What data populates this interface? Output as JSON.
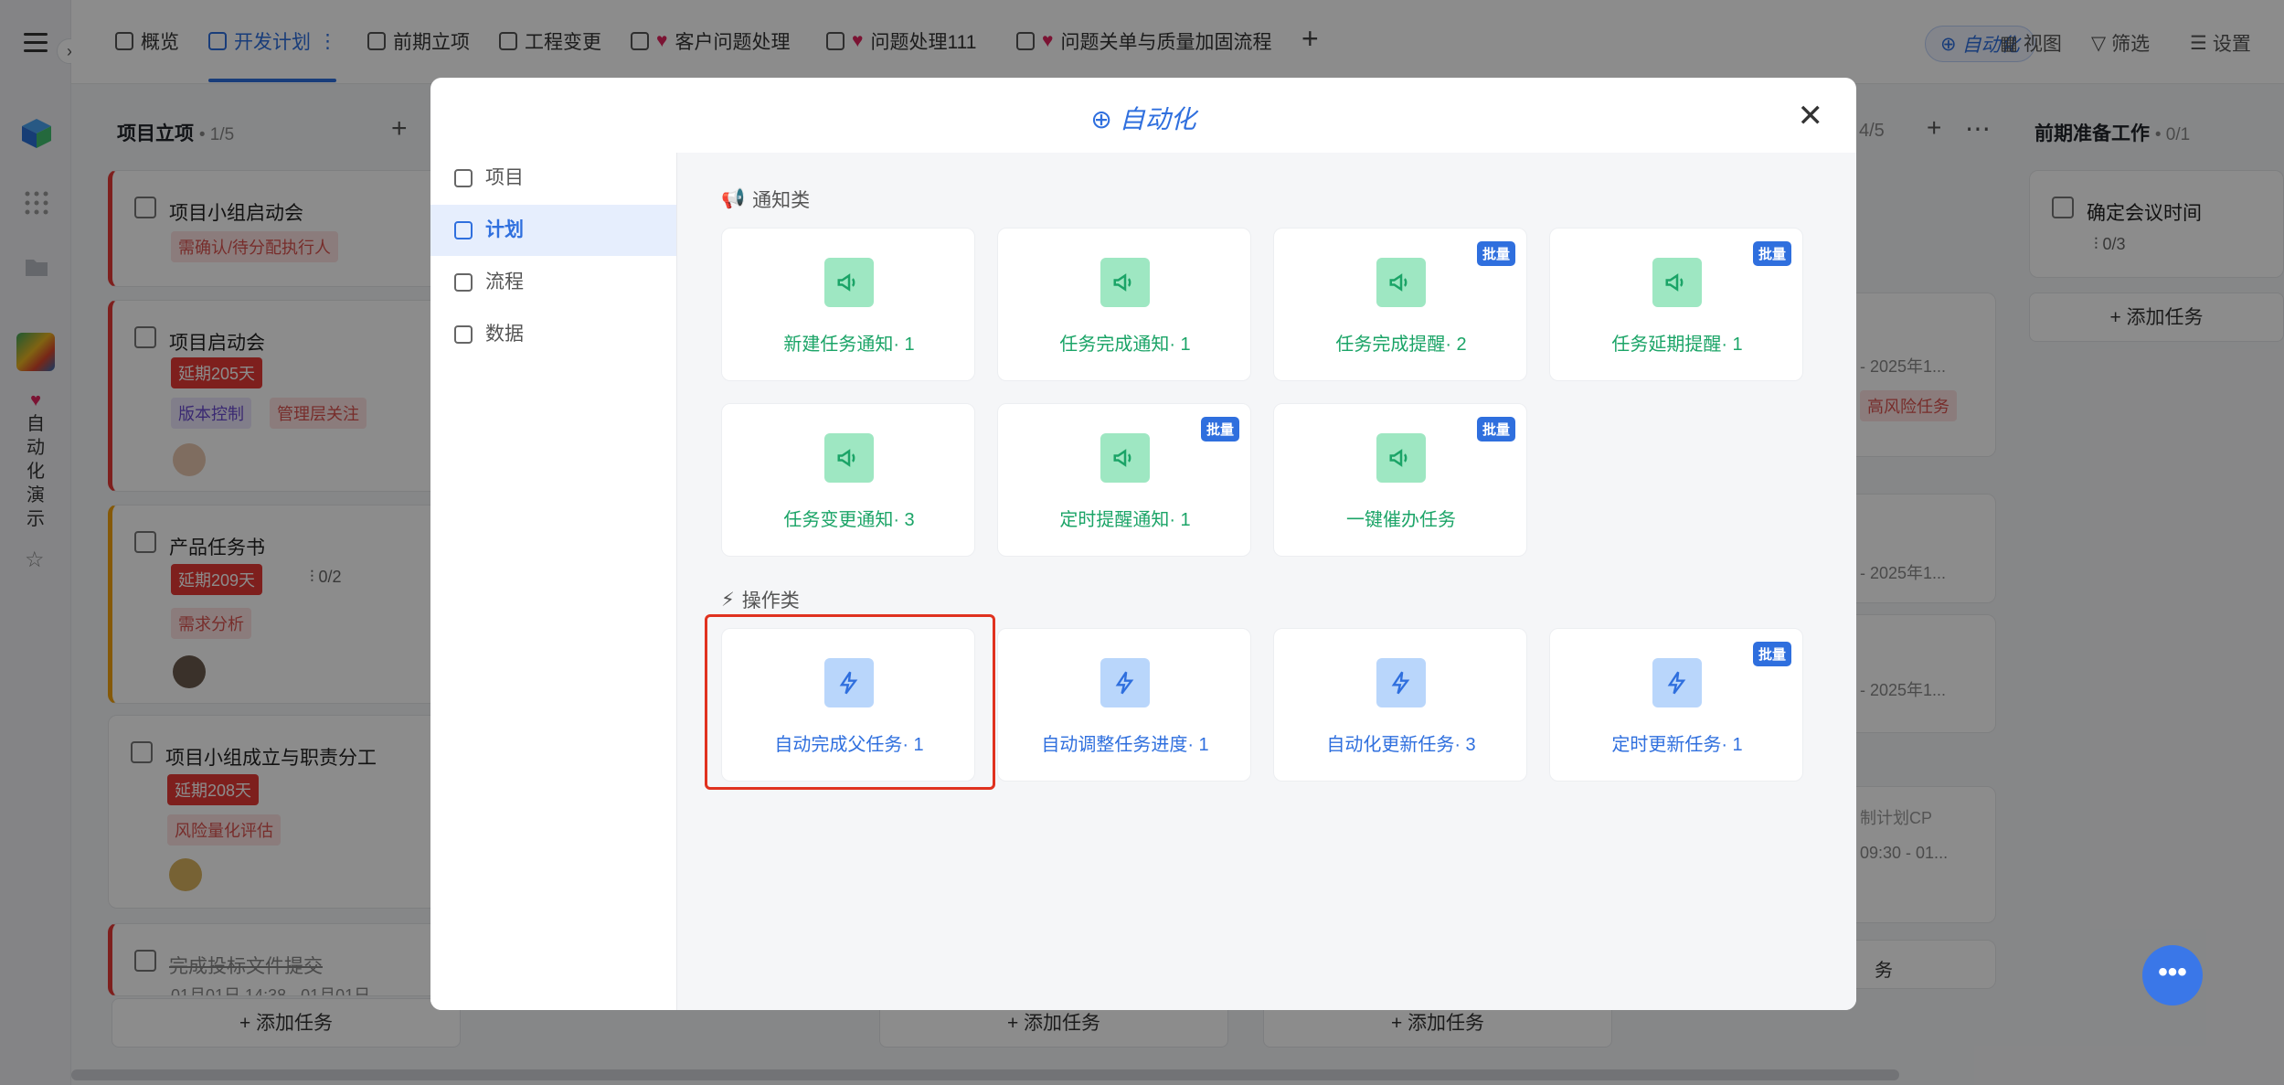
{
  "app": {
    "rail": {
      "workspace_label": "自动化演示"
    },
    "tabs": [
      {
        "label": "概览"
      },
      {
        "label": "开发计划"
      },
      {
        "label": "前期立项"
      },
      {
        "label": "工程变更"
      },
      {
        "label": "客户问题处理"
      },
      {
        "label": "问题处理111"
      },
      {
        "label": "问题关单与质量加固流程"
      }
    ],
    "toolbar": {
      "automation": "自动化",
      "view": "视图",
      "filter": "筛选",
      "settings": "设置"
    }
  },
  "board": {
    "columns": [
      {
        "title": "项目立项",
        "count": "• 1/5"
      },
      {
        "title": "前期准备工作",
        "count": "• 0/1"
      }
    ],
    "partial_count": "4/5",
    "cards": [
      {
        "title": "项目小组启动会",
        "tags": [
          "需确认/待分配执行人"
        ]
      },
      {
        "title": "项目启动会",
        "delay": "延期205天",
        "tags": [
          "版本控制",
          "管理层关注"
        ]
      },
      {
        "title": "产品任务书",
        "delay": "延期209天",
        "sub": "0/2",
        "tags": [
          "需求分析"
        ]
      },
      {
        "title": "项目小组成立与职责分工",
        "delay": "延期208天",
        "tags": [
          "风险量化评估"
        ]
      },
      {
        "title": "完成投标文件提交",
        "date": "01月01日 14:38 - 01月01日 ..."
      }
    ],
    "right_card": {
      "title": "确定会议时间",
      "sub": "0/3"
    },
    "right_col_snippets": [
      "- 2025年1...",
      "高风险任务",
      "- 2025年1...",
      "- 2025年1...",
      "制计划CP",
      "09:30 - 01...",
      "务"
    ],
    "add_task": "添加任务"
  },
  "modal": {
    "title": "自动化",
    "nav": [
      {
        "label": "项目"
      },
      {
        "label": "计划"
      },
      {
        "label": "流程"
      },
      {
        "label": "数据"
      }
    ],
    "sections": [
      {
        "title": "通知类",
        "items": [
          {
            "label": "新建任务通知· 1",
            "badge": ""
          },
          {
            "label": "任务完成通知· 1",
            "badge": ""
          },
          {
            "label": "任务完成提醒· 2",
            "badge": "批量"
          },
          {
            "label": "任务延期提醒· 1",
            "badge": "批量"
          },
          {
            "label": "任务变更通知· 3",
            "badge": ""
          },
          {
            "label": "定时提醒通知· 1",
            "badge": "批量"
          },
          {
            "label": "一键催办任务",
            "badge": "批量"
          }
        ]
      },
      {
        "title": "操作类",
        "items": [
          {
            "label": "自动完成父任务· 1",
            "badge": ""
          },
          {
            "label": "自动调整任务进度· 1",
            "badge": ""
          },
          {
            "label": "自动化更新任务· 3",
            "badge": ""
          },
          {
            "label": "定时更新任务· 1",
            "badge": "批量"
          }
        ]
      }
    ]
  },
  "colors": {
    "accent": "#2f6fde",
    "notify_green": "#1ba467",
    "highlight_red": "#e0321f"
  }
}
